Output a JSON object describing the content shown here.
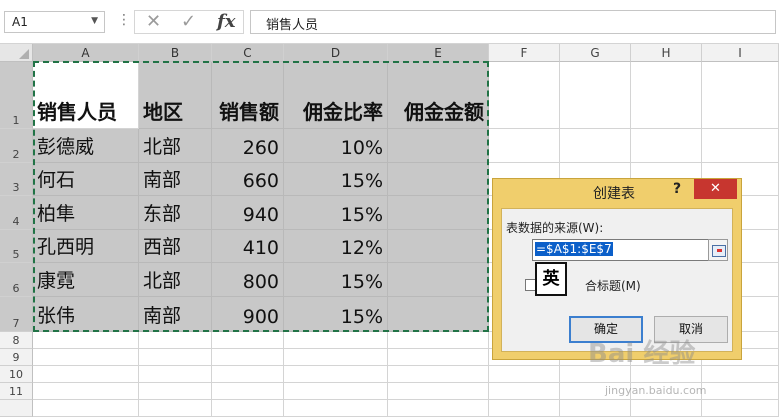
{
  "formula_bar": {
    "name_box": "A1",
    "more_symbol": "⋮",
    "cancel_symbol": "✕",
    "enter_symbol": "✓",
    "fx_symbol": "fx",
    "formula": "销售人员"
  },
  "columns": [
    "A",
    "B",
    "C",
    "D",
    "E",
    "F",
    "G",
    "H",
    "I"
  ],
  "rows": [
    "1",
    "2",
    "3",
    "4",
    "5",
    "6",
    "7",
    "8",
    "9",
    "10",
    "11"
  ],
  "table": {
    "headers": [
      "销售人员",
      "地区",
      "销售额",
      "佣金比率",
      "佣金金额"
    ],
    "records": [
      [
        "彭德威",
        "北部",
        "260",
        "10%",
        ""
      ],
      [
        "何石",
        "南部",
        "660",
        "15%",
        ""
      ],
      [
        "柏隼",
        "东部",
        "940",
        "15%",
        ""
      ],
      [
        "孔西明",
        "西部",
        "410",
        "12%",
        ""
      ],
      [
        "康霓",
        "北部",
        "800",
        "15%",
        ""
      ],
      [
        "张伟",
        "南部",
        "900",
        "15%",
        ""
      ]
    ]
  },
  "dialog": {
    "title": "创建表",
    "help": "?",
    "close": "✕",
    "source_label": "表数据的来源(W):",
    "range_value": "=$A$1:$E$7",
    "header_checkbox_label": "合标题(M)",
    "ok_label": "确定",
    "cancel_label": "取消"
  },
  "ime_indicator": "英",
  "watermark": "Bai 经验",
  "watermark_sub": "jingyan.baidu.com",
  "colors": {
    "selection_fill": "#c8c8c8",
    "marquee": "#217346",
    "dialog_frame": "#f0ce6c",
    "close_button": "#c7362f"
  }
}
